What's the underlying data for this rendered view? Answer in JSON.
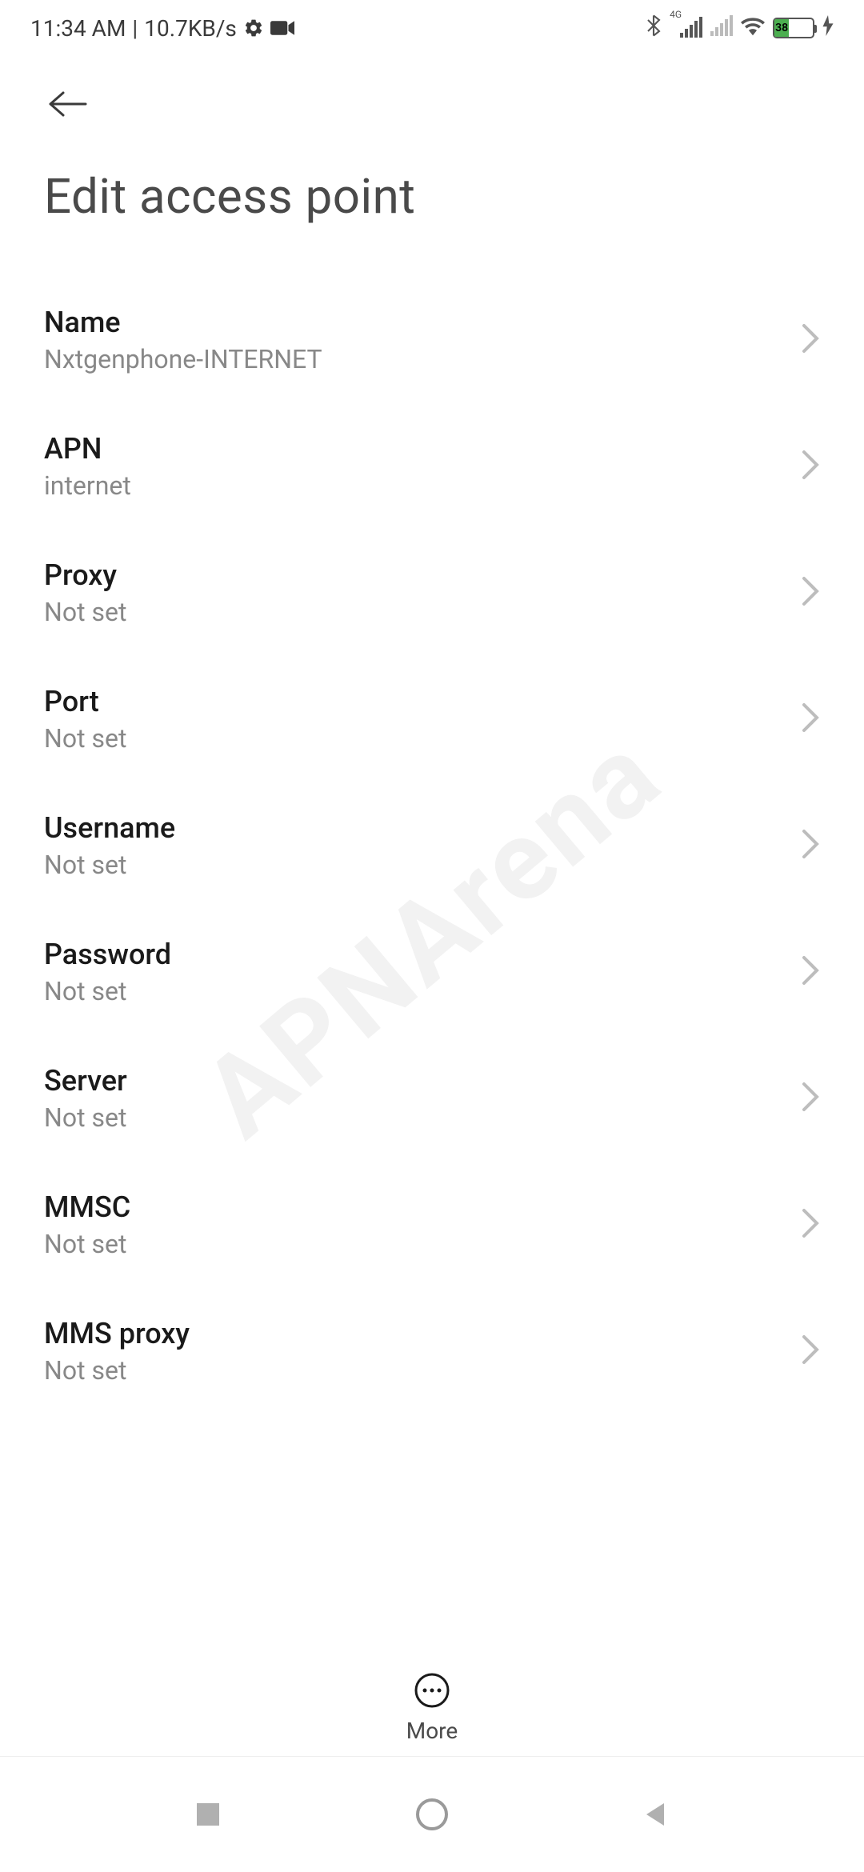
{
  "status_bar": {
    "time": "11:34 AM",
    "separator": "|",
    "data_rate": "10.7KB/s",
    "network_label": "4G",
    "battery_percent": "38"
  },
  "header": {
    "page_title": "Edit access point"
  },
  "settings": [
    {
      "label": "Name",
      "value": "Nxtgenphone-INTERNET"
    },
    {
      "label": "APN",
      "value": "internet"
    },
    {
      "label": "Proxy",
      "value": "Not set"
    },
    {
      "label": "Port",
      "value": "Not set"
    },
    {
      "label": "Username",
      "value": "Not set"
    },
    {
      "label": "Password",
      "value": "Not set"
    },
    {
      "label": "Server",
      "value": "Not set"
    },
    {
      "label": "MMSC",
      "value": "Not set"
    },
    {
      "label": "MMS proxy",
      "value": "Not set"
    }
  ],
  "bottom_bar": {
    "more_label": "More"
  },
  "watermark": "APNArena"
}
